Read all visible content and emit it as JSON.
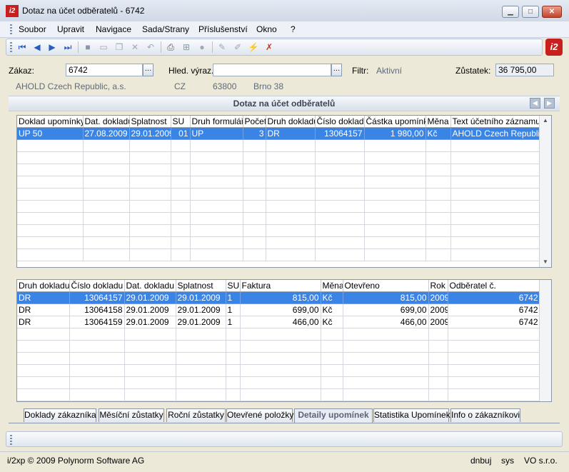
{
  "window": {
    "title": "Dotaz na účet odběratelů - 6742",
    "app_logo": "i2"
  },
  "menu": [
    "Soubor",
    "Upravit",
    "Navigace",
    "Sada/Strany",
    "Příslušenství",
    "Okno",
    "?"
  ],
  "toolbar_icons": [
    "first-icon",
    "prev-icon",
    "next-icon",
    "last-icon",
    "save-icon",
    "new-icon",
    "copy-icon",
    "delete-icon",
    "undo-icon",
    "print-icon",
    "tree-icon",
    "stop-icon",
    "edit-icon",
    "pen-icon",
    "lightning-icon",
    "filter-x-icon"
  ],
  "form": {
    "zakaz_label": "Zákaz:",
    "zakaz_value": "6742",
    "hled_label": "Hled. výraz.:",
    "hled_value": "",
    "filtr_label": "Filtr:",
    "filtr_value": "Aktivní",
    "zustatek_label": "Zůstatek:",
    "zustatek_value": "36 795,00",
    "customer_name": "AHOLD Czech Republic, a.s.",
    "country": "CZ",
    "zip": "63800",
    "city": "Brno 38"
  },
  "panel": {
    "title": "Dotaz na účet odběratelů"
  },
  "grid_top": {
    "columns": [
      "Doklad upomínky",
      "Dat. dokladu",
      "Splatnost",
      "SU",
      "Druh formuláře",
      "Počet",
      "Druh dokladu",
      "Číslo dokladu",
      "Částka upomínky",
      "Měna",
      "Text účetního záznamu"
    ],
    "rows": [
      [
        "UP 50",
        "27.08.2009",
        "29.01.2009",
        "01",
        "UP",
        "3",
        "DR",
        "13064157",
        "1 980,00",
        "Kč",
        "AHOLD Czech Republic, a.s."
      ]
    ]
  },
  "grid_bottom": {
    "columns": [
      "Druh dokladu",
      "Číslo dokladu",
      "Dat. dokladu",
      "Splatnost",
      "SU",
      "Faktura",
      "Měna",
      "Otevřeno",
      "Rok",
      "Odběratel č."
    ],
    "rows": [
      [
        "DR",
        "13064157",
        "29.01.2009",
        "29.01.2009",
        "1",
        "815,00",
        "Kč",
        "815,00",
        "2009",
        "6742"
      ],
      [
        "DR",
        "13064158",
        "29.01.2009",
        "29.01.2009",
        "1",
        "699,00",
        "Kč",
        "699,00",
        "2009",
        "6742"
      ],
      [
        "DR",
        "13064159",
        "29.01.2009",
        "29.01.2009",
        "1",
        "466,00",
        "Kč",
        "466,00",
        "2009",
        "6742"
      ]
    ]
  },
  "tabs": [
    "Doklady zákazníka",
    "Měsíční zůstatky",
    "Roční zůstatky",
    "Otevřené položky",
    "Detaily upomínek",
    "Statistika Upomínek",
    "Info o zákazníkovi"
  ],
  "active_tab": "Detaily upomínek",
  "status": {
    "copyright": "i/2xp © 2009 Polynorm Software AG",
    "user": "dnbuj",
    "db": "sys",
    "company": "VO s.r.o."
  }
}
